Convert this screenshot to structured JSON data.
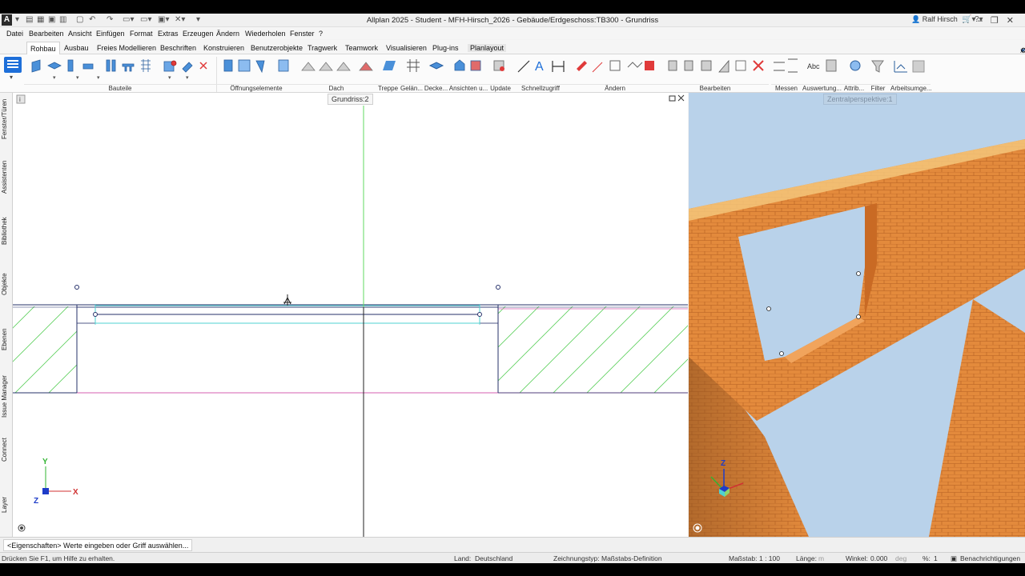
{
  "window": {
    "logo": "A",
    "title": "Allplan 2025 - Student - MFH-Hirsch_2026 - Gebäude/Erdgeschoss:TB300 - Grundriss",
    "user": "Ralf Hirsch"
  },
  "menu": [
    "Datei",
    "Bearbeiten",
    "Ansicht",
    "Einfügen",
    "Format",
    "Extras",
    "Erzeugen",
    "Ändern",
    "Wiederholen",
    "Fenster",
    "?"
  ],
  "tabs": [
    "Rohbau",
    "Ausbau",
    "Freies Modellieren",
    "Beschriften",
    "Konstruieren",
    "Benutzerobjekte",
    "Tragwerk",
    "Teamwork",
    "Visualisieren",
    "Plug-ins",
    "Planlayout"
  ],
  "active_tab": "Rohbau",
  "ribbon_groups": [
    "Bauteile",
    "Öffnungselemente",
    "Dach",
    "Treppe",
    "Gelän...",
    "Decke...",
    "Ansichten u...",
    "Update",
    "Schnellzugriff",
    "Ändern",
    "Bearbeiten",
    "Messen",
    "Auswertung...",
    "Attrib...",
    "Filter",
    "Arbeitsumge..."
  ],
  "side_tabs": [
    "Fenster/Türen",
    "Assistenten",
    "Bibliothek",
    "Objekte",
    "Ebenen",
    "Issue Manager",
    "Connect",
    "Layer"
  ],
  "viewports": {
    "plan_title": "Grundriss:2",
    "view3d_title": "Zentralperspektive:1",
    "axes_2d": {
      "x": "X",
      "y": "Y",
      "z": "Z"
    },
    "axes_3d": {
      "z": "Z"
    }
  },
  "command_prompt": "<Eigenschaften> Werte eingeben oder Griff auswählen...",
  "status": {
    "help": "Drücken Sie F1, um Hilfe zu erhalten.",
    "country_label": "Land:",
    "country": "Deutschland",
    "drawing_type_label": "Zeichnungstyp:",
    "drawing_type": "Maßstabs-Definition",
    "scale_label": "Maßstab:",
    "scale": "1 : 100",
    "length_label": "Länge:",
    "length_unit": "m",
    "angle_label": "Winkel:",
    "angle": "0.000",
    "angle_unit": "deg",
    "percent_label": "%:",
    "percent": "1",
    "notifications": "Benachrichtigungen"
  },
  "colors": {
    "accent": "#1e6fd9",
    "wall_brick": "#e0893a",
    "sky": "#b9d2ea",
    "hatch": "#5ccf5c",
    "guide_green": "#62d962",
    "cyan": "#4fd1d1",
    "magenta": "#d65fb0"
  }
}
